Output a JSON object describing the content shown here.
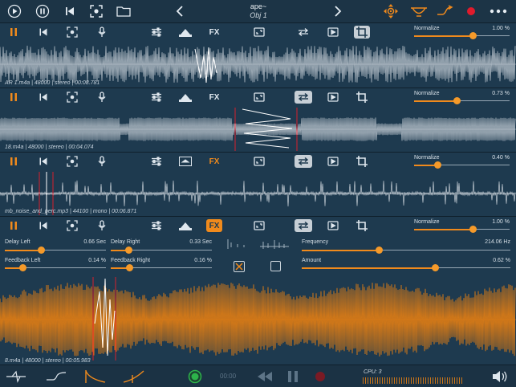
{
  "title": {
    "main": "ape~",
    "sub": "Obj 1"
  },
  "colors": {
    "accent": "#f08a1c",
    "background": "#1e3a4f",
    "record": "#e01b2c",
    "play": "#2db34a"
  },
  "topbar": {
    "left_icons": [
      "play-icon",
      "pause-icon",
      "skip-start-icon",
      "focus-icon",
      "folder-icon"
    ],
    "nav_icons": [
      "chevron-left-icon",
      "chevron-right-icon"
    ],
    "right_icons": [
      "move-target-icon",
      "bowl-icon",
      "curve-arrow-icon",
      "record-icon",
      "more-icon"
    ]
  },
  "tracks": [
    {
      "info": "AR 1.m4a | 48000 | stereo | 00:08.781",
      "normalize_label": "Normalize",
      "normalize_value": "1.00 %",
      "normalize_level": 0.62
    },
    {
      "info": "18.m4a | 48000 | stereo | 00:04.074",
      "normalize_label": "Normalize",
      "normalize_value": "0.73 %",
      "normalize_level": 0.45
    },
    {
      "info": "mb_noise_and_perc.mp3 | 44100 | mono | 00:06.871",
      "normalize_label": "Normalize",
      "normalize_value": "0.40 %",
      "normalize_level": 0.25
    },
    {
      "info": "8.m4a | 48000 | stereo | 00:05.983",
      "normalize_label": "Normalize",
      "normalize_value": "1.00 %",
      "normalize_level": 0.62
    }
  ],
  "fx_label": "FX",
  "fx_panel": {
    "delay_left": {
      "label": "Delay Left",
      "value": "0.66 Sec",
      "level": 0.36
    },
    "delay_right": {
      "label": "Delay Right",
      "value": "0.33 Sec",
      "level": 0.18
    },
    "feedback_left": {
      "label": "Feedback Left",
      "value": "0.14 %",
      "level": 0.18
    },
    "feedback_right": {
      "label": "Feedback Right",
      "value": "0.16 %",
      "level": 0.19
    },
    "frequency": {
      "label": "Frequency",
      "value": "214.06 Hz",
      "level": 0.37
    },
    "amount": {
      "label": "Amount",
      "value": "0.62 %",
      "level": 0.64
    }
  },
  "bottombar": {
    "time": "00:00",
    "cpu_label": "CPU: 3",
    "icons": [
      "envelope-icon",
      "step-curve-icon",
      "fade-out-icon",
      "fade-in-icon",
      "play-circle-icon",
      "rewind-icon",
      "pause-icon",
      "stop-icon",
      "speaker-icon"
    ]
  }
}
